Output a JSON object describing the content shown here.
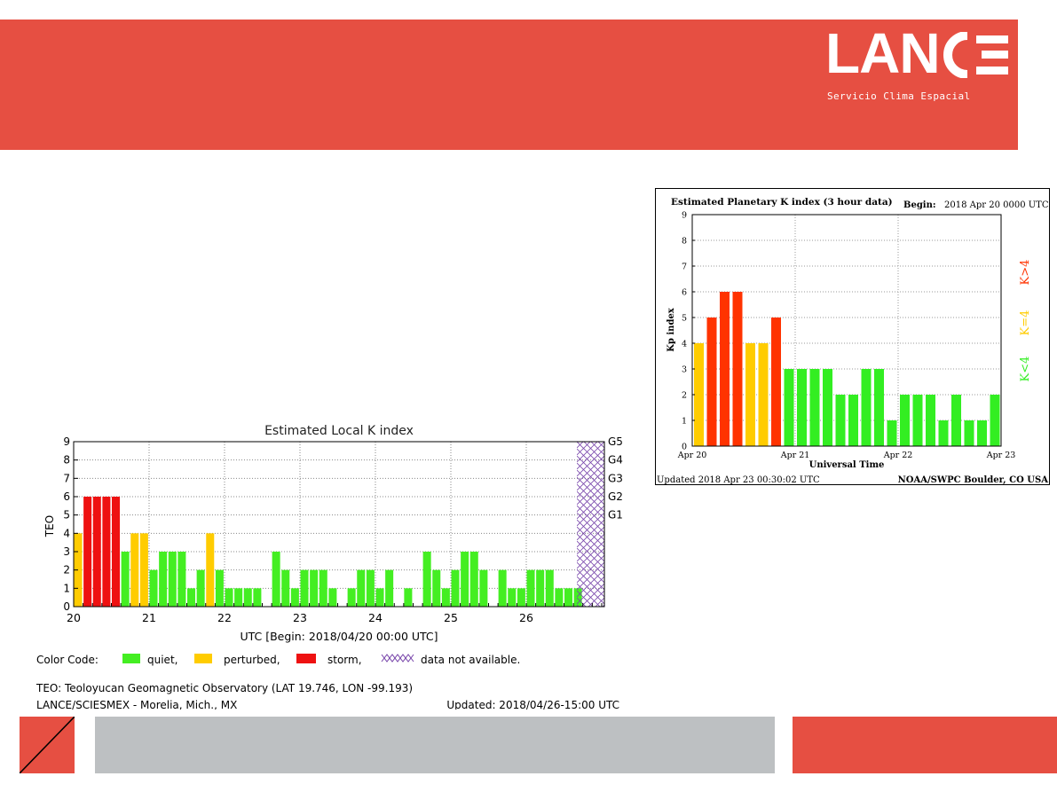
{
  "header": {
    "logo_text": "LANCE",
    "subtitle": "Servicio Clima Espacial",
    "color": "#e64f42"
  },
  "footer": {
    "gray": "#bdc0c2",
    "red": "#e64f42"
  },
  "chart_data": [
    {
      "type": "bar",
      "title": "Estimated Local K index",
      "xlabel": "UTC [Begin: 2018/04/20 00:00 UTC]",
      "ylabel": "TEO",
      "ylim": [
        0,
        9
      ],
      "yticks": [
        "0",
        "1",
        "2",
        "3",
        "4",
        "5",
        "6",
        "7",
        "8",
        "9"
      ],
      "xticks": [
        "20",
        "21",
        "22",
        "23",
        "24",
        "25",
        "26"
      ],
      "right_labels": [
        "G1",
        "G2",
        "G3",
        "G4",
        "G5"
      ],
      "grid": true,
      "values": [
        4,
        6,
        6,
        6,
        6,
        3,
        4,
        4,
        2,
        3,
        3,
        3,
        1,
        2,
        4,
        2,
        1,
        1,
        1,
        1,
        0,
        3,
        2,
        1,
        2,
        2,
        2,
        1,
        0,
        1,
        2,
        2,
        1,
        2,
        0,
        1,
        0,
        3,
        2,
        1,
        2,
        3,
        3,
        2,
        0,
        2,
        1,
        1,
        2,
        2,
        2,
        1,
        1,
        1
      ],
      "colors": {
        "quiet": "#44ee22",
        "perturbed": "#ffcc00",
        "storm": "#ee1111",
        "na": "#7744aa"
      },
      "legend": {
        "prefix": "Color Code:",
        "quiet": "quiet,",
        "perturbed": "perturbed,",
        "storm": "storm,",
        "na": "data not available."
      },
      "footnote1": "TEO: Teoloyucan Geomagnetic Observatory (LAT  19.746, LON -99.193)",
      "footnote2": "LANCE/SCIESMEX - Morelia, Mich., MX",
      "updated": "Updated: 2018/04/26-15:00 UTC"
    },
    {
      "type": "bar",
      "title": "Estimated Planetary K index (3 hour data)",
      "begin_label": "Begin:",
      "begin_value": "2018 Apr 20 0000 UTC",
      "xlabel": "Universal Time",
      "ylabel": "Kp index",
      "ylim": [
        0,
        9
      ],
      "yticks": [
        "0",
        "1",
        "2",
        "3",
        "4",
        "5",
        "6",
        "7",
        "8",
        "9"
      ],
      "xticks": [
        "Apr 20",
        "Apr 21",
        "Apr 22",
        "Apr 23"
      ],
      "grid": true,
      "values": [
        4,
        5,
        6,
        6,
        4,
        4,
        5,
        3,
        3,
        3,
        3,
        2,
        2,
        3,
        3,
        1,
        2,
        2,
        2,
        1,
        2,
        1,
        1,
        2
      ],
      "key": {
        "high": "K>4",
        "mid": "K=4",
        "low": "K<4"
      },
      "colors": {
        "low": "#33ee22",
        "mid": "#ffcc00",
        "high": "#ff3300"
      },
      "updated": "Updated 2018 Apr 23 00:30:02 UTC",
      "source": "NOAA/SWPC Boulder, CO USA"
    }
  ]
}
